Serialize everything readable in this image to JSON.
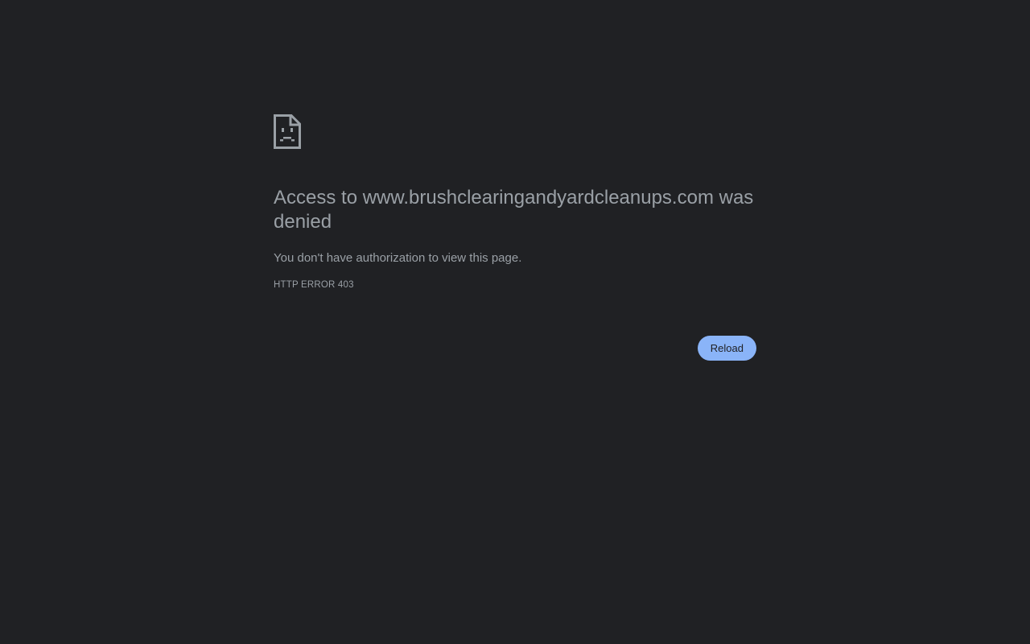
{
  "error": {
    "icon": "sad-page-icon",
    "heading": "Access to www.brushclearingandyardcleanups.com was denied",
    "message": "You don't have authorization to view this page.",
    "code": "HTTP ERROR 403"
  },
  "actions": {
    "reload_label": "Reload"
  },
  "colors": {
    "background": "#202124",
    "text": "#9aa0a6",
    "button": "#8ab4f8",
    "button_text": "#202124"
  }
}
